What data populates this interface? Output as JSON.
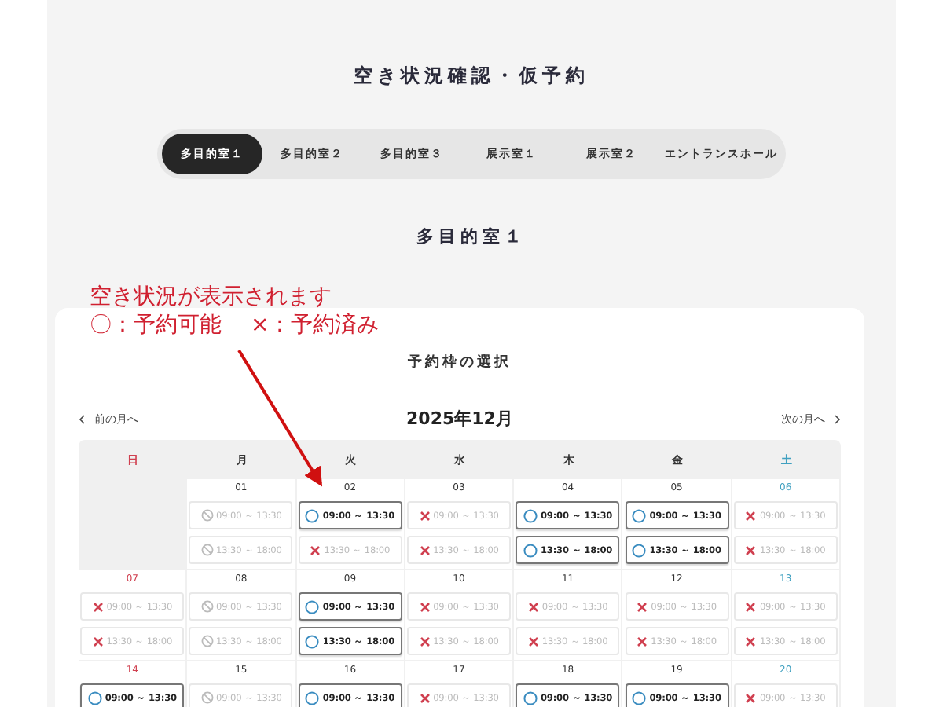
{
  "page_title": "空き状況確認・仮予約",
  "tabs": [
    {
      "label": "多目的室１",
      "selected": true
    },
    {
      "label": "多目的室２",
      "selected": false
    },
    {
      "label": "多目的室３",
      "selected": false
    },
    {
      "label": "展示室１",
      "selected": false
    },
    {
      "label": "展示室２",
      "selected": false
    },
    {
      "label": "エントランスホール",
      "selected": false
    }
  ],
  "room_title": "多目的室１",
  "annotation": {
    "lines": [
      "空き状況が表示されます",
      "〇：予約可能　 ×：予約済み"
    ]
  },
  "card": {
    "title": "予約枠の選択",
    "prev": "前の月へ",
    "month": "2025年12月",
    "next": "次の月へ",
    "weekdays": [
      {
        "label": "日",
        "kind": "sun"
      },
      {
        "label": "月",
        "kind": "weekday"
      },
      {
        "label": "火",
        "kind": "weekday"
      },
      {
        "label": "水",
        "kind": "weekday"
      },
      {
        "label": "木",
        "kind": "weekday"
      },
      {
        "label": "金",
        "kind": "weekday"
      },
      {
        "label": "土",
        "kind": "sat"
      }
    ],
    "weeks": [
      [
        {
          "kind": "empty"
        },
        {
          "day": "01",
          "kind": "weekday",
          "slots": [
            {
              "time": "09:00 ～ 13:30",
              "kind": "closed"
            },
            {
              "time": "13:30 ～ 18:00",
              "kind": "closed"
            }
          ]
        },
        {
          "day": "02",
          "kind": "weekday",
          "slots": [
            {
              "time": "09:00 ～ 13:30",
              "kind": "open"
            },
            {
              "time": "13:30 ～ 18:00",
              "kind": "booked"
            }
          ]
        },
        {
          "day": "03",
          "kind": "weekday",
          "slots": [
            {
              "time": "09:00 ～ 13:30",
              "kind": "booked"
            },
            {
              "time": "13:30 ～ 18:00",
              "kind": "booked"
            }
          ]
        },
        {
          "day": "04",
          "kind": "weekday",
          "slots": [
            {
              "time": "09:00 ～ 13:30",
              "kind": "open"
            },
            {
              "time": "13:30 ～ 18:00",
              "kind": "open"
            }
          ]
        },
        {
          "day": "05",
          "kind": "weekday",
          "slots": [
            {
              "time": "09:00 ～ 13:30",
              "kind": "open"
            },
            {
              "time": "13:30 ～ 18:00",
              "kind": "open"
            }
          ]
        },
        {
          "day": "06",
          "kind": "sat",
          "slots": [
            {
              "time": "09:00 ～ 13:30",
              "kind": "booked"
            },
            {
              "time": "13:30 ～ 18:00",
              "kind": "booked"
            }
          ]
        }
      ],
      [
        {
          "day": "07",
          "kind": "sun",
          "slots": [
            {
              "time": "09:00 ～ 13:30",
              "kind": "booked"
            },
            {
              "time": "13:30 ～ 18:00",
              "kind": "booked"
            }
          ]
        },
        {
          "day": "08",
          "kind": "weekday",
          "slots": [
            {
              "time": "09:00 ～ 13:30",
              "kind": "closed"
            },
            {
              "time": "13:30 ～ 18:00",
              "kind": "closed"
            }
          ]
        },
        {
          "day": "09",
          "kind": "weekday",
          "slots": [
            {
              "time": "09:00 ～ 13:30",
              "kind": "open"
            },
            {
              "time": "13:30 ～ 18:00",
              "kind": "open"
            }
          ]
        },
        {
          "day": "10",
          "kind": "weekday",
          "slots": [
            {
              "time": "09:00 ～ 13:30",
              "kind": "booked"
            },
            {
              "time": "13:30 ～ 18:00",
              "kind": "booked"
            }
          ]
        },
        {
          "day": "11",
          "kind": "weekday",
          "slots": [
            {
              "time": "09:00 ～ 13:30",
              "kind": "booked"
            },
            {
              "time": "13:30 ～ 18:00",
              "kind": "booked"
            }
          ]
        },
        {
          "day": "12",
          "kind": "weekday",
          "slots": [
            {
              "time": "09:00 ～ 13:30",
              "kind": "booked"
            },
            {
              "time": "13:30 ～ 18:00",
              "kind": "booked"
            }
          ]
        },
        {
          "day": "13",
          "kind": "sat",
          "slots": [
            {
              "time": "09:00 ～ 13:30",
              "kind": "booked"
            },
            {
              "time": "13:30 ～ 18:00",
              "kind": "booked"
            }
          ]
        }
      ],
      [
        {
          "day": "14",
          "kind": "sun",
          "slots": [
            {
              "time": "09:00 ～ 13:30",
              "kind": "open"
            }
          ]
        },
        {
          "day": "15",
          "kind": "weekday",
          "slots": [
            {
              "time": "09:00 ～ 13:30",
              "kind": "closed"
            }
          ]
        },
        {
          "day": "16",
          "kind": "weekday",
          "slots": [
            {
              "time": "09:00 ～ 13:30",
              "kind": "open"
            }
          ]
        },
        {
          "day": "17",
          "kind": "weekday",
          "slots": [
            {
              "time": "09:00 ～ 13:30",
              "kind": "booked"
            }
          ]
        },
        {
          "day": "18",
          "kind": "weekday",
          "slots": [
            {
              "time": "09:00 ～ 13:30",
              "kind": "open"
            }
          ]
        },
        {
          "day": "19",
          "kind": "weekday",
          "slots": [
            {
              "time": "09:00 ～ 13:30",
              "kind": "open"
            }
          ]
        },
        {
          "day": "20",
          "kind": "sat",
          "slots": [
            {
              "time": "09:00 ～ 13:30",
              "kind": "booked"
            }
          ]
        }
      ]
    ]
  }
}
